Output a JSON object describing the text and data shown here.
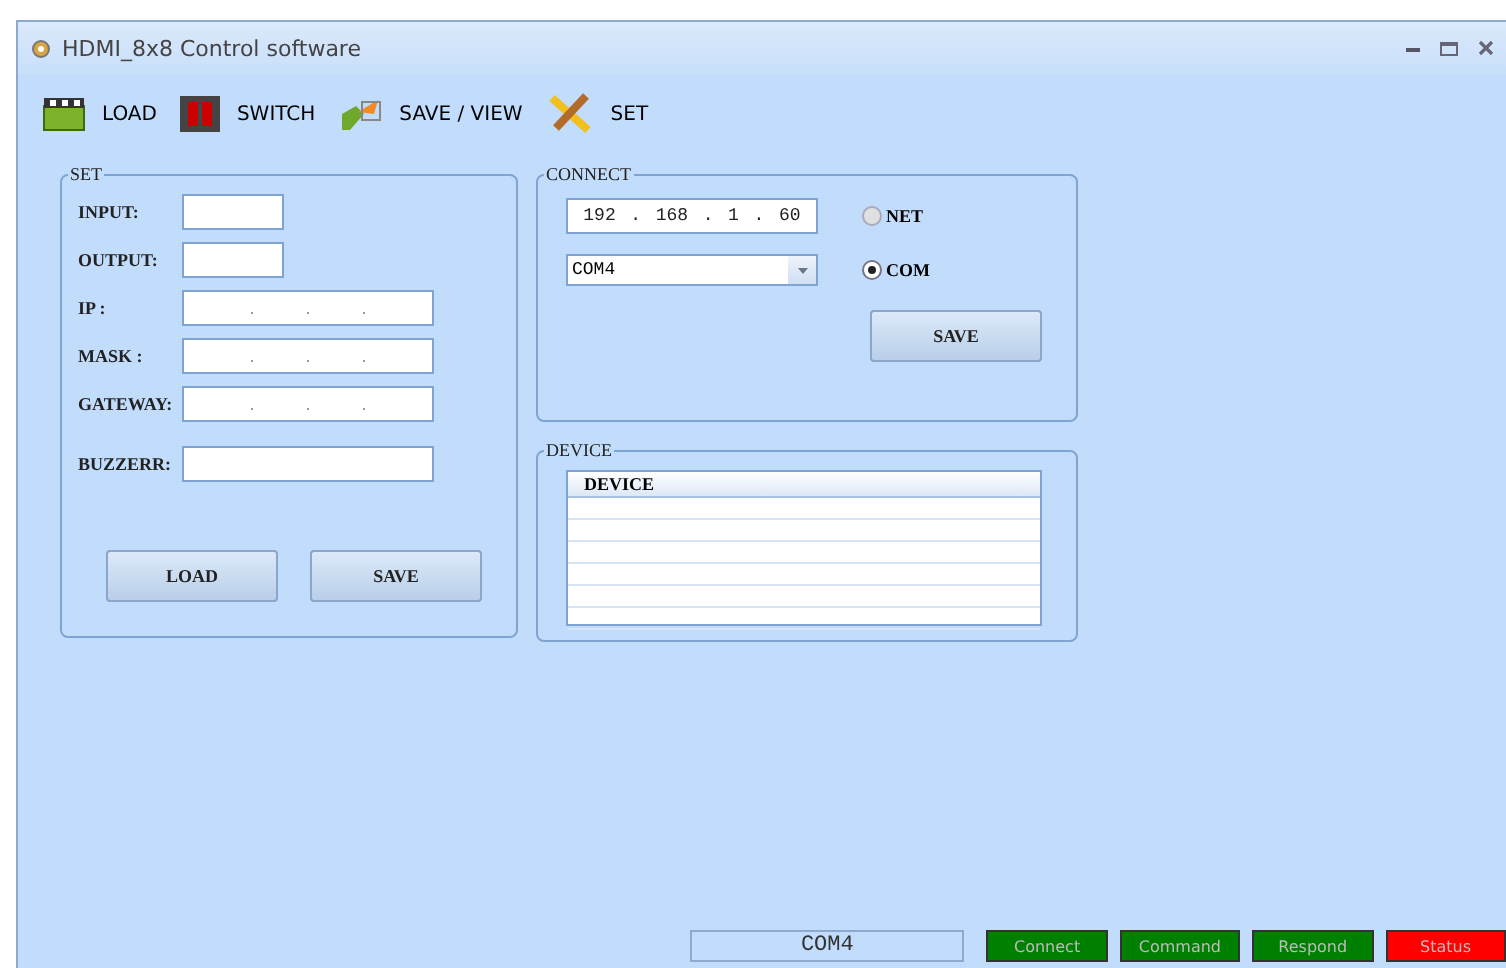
{
  "window": {
    "title": "HDMI_8x8 Control software"
  },
  "toolbar": [
    {
      "kind": "clapper",
      "label": "LOAD"
    },
    {
      "kind": "switch",
      "label": "SWITCH"
    },
    {
      "kind": "save",
      "label": "SAVE / VIEW"
    },
    {
      "kind": "tools",
      "label": "SET"
    }
  ],
  "set_panel": {
    "title": "SET",
    "fields": [
      {
        "kind": "short",
        "label": "INPUT:"
      },
      {
        "kind": "short",
        "label": "OUTPUT:"
      },
      {
        "kind": "ip",
        "label": "IP :",
        "separators": [
          ".",
          ".",
          "."
        ]
      },
      {
        "kind": "ip",
        "label": "MASK :",
        "separators": [
          ".",
          ".",
          "."
        ]
      },
      {
        "kind": "ip",
        "label": "GATEWAY:",
        "separators": [
          ".",
          ".",
          "."
        ]
      },
      {
        "kind": "wide",
        "label": "BUZZERR:"
      }
    ],
    "buttons": [
      "LOAD",
      "SAVE"
    ]
  },
  "connect_panel": {
    "title": "CONNECT",
    "ip_parts": [
      "192",
      ".",
      "168",
      ".",
      "1",
      ".",
      "60"
    ],
    "port": "COM4",
    "modes": [
      {
        "label": "NET",
        "selected": false
      },
      {
        "label": "COM",
        "selected": true
      }
    ],
    "button": "SAVE"
  },
  "device_panel": {
    "title": "DEVICE",
    "columns": [
      "DEVICE"
    ]
  },
  "status_bar": {
    "port": "COM4",
    "indicators": [
      {
        "label": "Connect",
        "color": "#008000"
      },
      {
        "label": "Command",
        "color": "#008000"
      },
      {
        "label": "Respond",
        "color": "#008000"
      },
      {
        "label": "Status",
        "color": "#ff0000"
      }
    ]
  }
}
